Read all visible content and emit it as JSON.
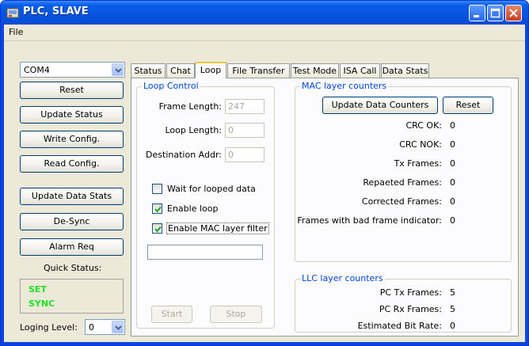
{
  "window": {
    "title": "PLC, SLAVE"
  },
  "menu": {
    "file": "File"
  },
  "left": {
    "port": "COM4",
    "buttons": [
      "Reset",
      "Update Status",
      "Write Config.",
      "Read Config.",
      "Update Data Stats",
      "De-Sync",
      "Alarm Req"
    ],
    "quick_status_label": "Quick Status:",
    "status_lines": [
      "SET",
      "SYNC"
    ],
    "logging_label": "Loging Level:",
    "logging_value": "0"
  },
  "tabs": [
    "Status",
    "Chat",
    "Loop",
    "File Transfer",
    "Test Mode",
    "ISA Call",
    "Data Stats"
  ],
  "active_tab": "Loop",
  "loop": {
    "group_title": "Loop Control",
    "frame_length_label": "Frame Length:",
    "frame_length_value": "247",
    "loop_length_label": "Loop Length:",
    "loop_length_value": "0",
    "dest_addr_label": "Destination Addr:",
    "dest_addr_value": "0",
    "wait_label": "Wait for looped data",
    "enable_loop_label": "Enable loop",
    "enable_mac_label": "Enable MAC layer filter",
    "wait_checked": false,
    "enable_loop_checked": true,
    "enable_mac_checked": true,
    "start_label": "Start",
    "stop_label": "Stop"
  },
  "mac": {
    "group_title": "MAC layer counters",
    "update_label": "Update Data Counters",
    "reset_label": "Reset",
    "counters": [
      {
        "label": "CRC OK:",
        "value": "0"
      },
      {
        "label": "CRC NOK:",
        "value": "0"
      },
      {
        "label": "Tx Frames:",
        "value": "0"
      },
      {
        "label": "Repaeted Frames:",
        "value": "0"
      },
      {
        "label": "Corrected Frames:",
        "value": "0"
      },
      {
        "label": "Frames with bad frame indicator:",
        "value": "0"
      }
    ]
  },
  "llc": {
    "group_title": "LLC layer counters",
    "counters": [
      {
        "label": "PC Tx Frames:",
        "value": "5"
      },
      {
        "label": "PC Rx Frames:",
        "value": "5"
      },
      {
        "label": "Estimated Bit Rate:",
        "value": "0"
      }
    ]
  },
  "colors": {
    "titlebar": "#0a5ee8",
    "status_green": "#22e022",
    "group_title": "#0046d5",
    "tab_highlight": "#ffc83c"
  }
}
